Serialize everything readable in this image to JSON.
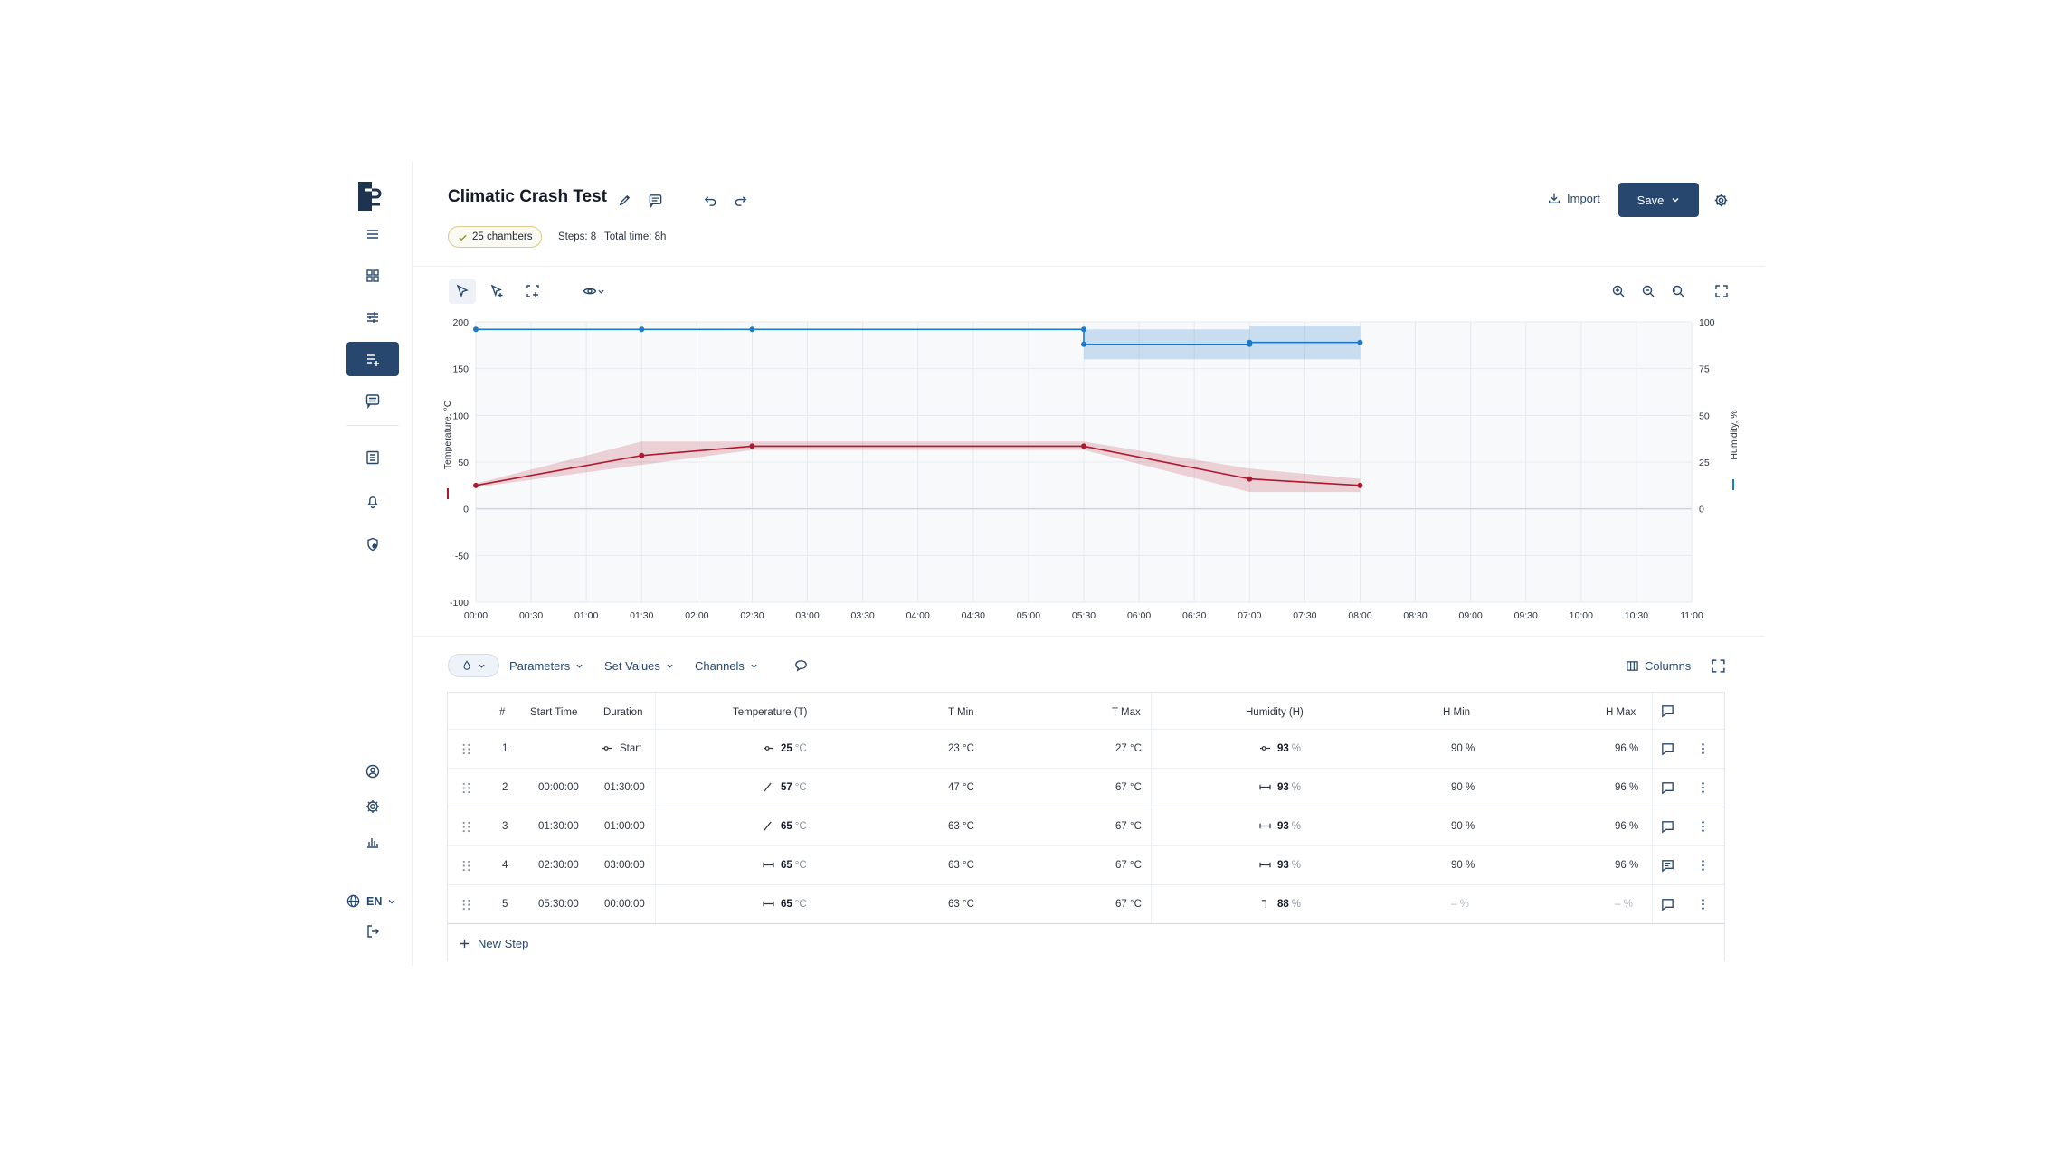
{
  "colors": {
    "accent": "#27476e",
    "temperature": "#b0182f",
    "humidity": "#1e7ac6",
    "chip_border": "#d9c98a"
  },
  "header": {
    "title": "Climatic Crash Test",
    "chambers_chip": "25 chambers",
    "steps": "Steps: 8",
    "total_time": "Total time: 8h",
    "import_label": "Import",
    "save_label": "Save"
  },
  "sidebar": {
    "language": "EN",
    "items": [
      {
        "icon": "logo-icon"
      },
      {
        "icon": "menu-icon"
      },
      {
        "icon": "dashboard-grid-icon"
      },
      {
        "icon": "sliders-icon"
      },
      {
        "icon": "profile-editor-icon",
        "active": true
      },
      {
        "icon": "messages-icon"
      },
      {
        "icon": "list-icon"
      },
      {
        "icon": "bell-icon"
      },
      {
        "icon": "badge-icon"
      },
      {
        "icon": "user-icon"
      },
      {
        "icon": "settings-icon"
      },
      {
        "icon": "stats-icon"
      },
      {
        "icon": "globe-icon"
      },
      {
        "icon": "logout-icon"
      }
    ]
  },
  "chart_data": {
    "type": "line",
    "x_ticks": [
      "00:00",
      "00:30",
      "01:00",
      "01:30",
      "02:00",
      "02:30",
      "03:00",
      "03:30",
      "04:00",
      "04:30",
      "05:00",
      "05:30",
      "06:00",
      "06:30",
      "07:00",
      "07:30",
      "08:00",
      "08:30",
      "09:00",
      "09:30",
      "10:00",
      "10:30",
      "11:00"
    ],
    "xlim_hours": [
      0,
      11
    ],
    "y_left": {
      "label": "Temperature, °C",
      "ticks": [
        200,
        150,
        100,
        50,
        0,
        -50,
        -100
      ],
      "lim": [
        -100,
        200
      ]
    },
    "y_right": {
      "label": "Humidity, %",
      "ticks": [
        100,
        75,
        50,
        25,
        0
      ],
      "lim": [
        -50,
        100
      ]
    },
    "grid": true,
    "series": [
      {
        "name": "Temperature",
        "axis": "left",
        "points": [
          [
            0,
            25
          ],
          [
            1.5,
            57
          ],
          [
            2.5,
            67
          ],
          [
            5.5,
            67
          ],
          [
            7,
            32
          ],
          [
            8,
            25
          ]
        ],
        "band_min": [
          [
            0,
            23
          ],
          [
            1.5,
            47
          ],
          [
            2.5,
            63
          ],
          [
            5.5,
            63
          ],
          [
            7,
            18
          ],
          [
            8,
            18
          ]
        ],
        "band_max": [
          [
            0,
            27
          ],
          [
            1.5,
            72
          ],
          [
            2.5,
            72
          ],
          [
            5.5,
            72
          ],
          [
            7,
            43
          ],
          [
            8,
            32
          ]
        ]
      },
      {
        "name": "Humidity",
        "axis": "right",
        "points": [
          [
            0,
            96
          ],
          [
            1.5,
            96
          ],
          [
            2.5,
            96
          ],
          [
            5.5,
            96
          ],
          [
            5.5,
            88
          ],
          [
            7,
            88
          ],
          [
            7,
            89
          ],
          [
            8,
            89
          ]
        ],
        "bands": [
          {
            "x": [
              5.5,
              7
            ],
            "min": 80,
            "max": 96
          },
          {
            "x": [
              7,
              8
            ],
            "min": 80,
            "max": 98
          }
        ]
      }
    ]
  },
  "filter_bar": {
    "parameters": "Parameters",
    "set_values": "Set Values",
    "channels": "Channels",
    "columns": "Columns"
  },
  "table": {
    "headers": [
      "#",
      "Start Time",
      "Duration",
      "Temperature (T)",
      "T Min",
      "T Max",
      "Humidity (H)",
      "H Min",
      "H Max"
    ],
    "rows": [
      {
        "n": "1",
        "start": "",
        "duration": "Start",
        "t_icon": "hold-icon",
        "t": "25",
        "t_unit": "°C",
        "tmin": "23 °C",
        "tmax": "27 °C",
        "h_icon": "hold-icon",
        "h": "93",
        "h_unit": "%",
        "hmin": "90 %",
        "hmax": "96 %"
      },
      {
        "n": "2",
        "start": "00:00:00",
        "duration": "01:30:00",
        "t_icon": "ramp-icon",
        "t": "57",
        "t_unit": "°C",
        "tmin": "47 °C",
        "tmax": "67 °C",
        "h_icon": "constant-icon",
        "h": "93",
        "h_unit": "%",
        "hmin": "90 %",
        "hmax": "96 %"
      },
      {
        "n": "3",
        "start": "01:30:00",
        "duration": "01:00:00",
        "t_icon": "ramp-icon",
        "t": "65",
        "t_unit": "°C",
        "tmin": "63 °C",
        "tmax": "67 °C",
        "h_icon": "constant-icon",
        "h": "93",
        "h_unit": "%",
        "hmin": "90 %",
        "hmax": "96 %"
      },
      {
        "n": "4",
        "start": "02:30:00",
        "duration": "03:00:00",
        "t_icon": "constant-icon",
        "t": "65",
        "t_unit": "°C",
        "tmin": "63 °C",
        "tmax": "67 °C",
        "h_icon": "constant-icon",
        "h": "93",
        "h_unit": "%",
        "hmin": "90 %",
        "hmax": "96 %"
      },
      {
        "n": "5",
        "start": "05:30:00",
        "duration": "00:00:00",
        "t_icon": "constant-icon",
        "t": "65",
        "t_unit": "°C",
        "tmin": "63 °C",
        "tmax": "67 °C",
        "h_icon": "step-icon",
        "h": "88",
        "h_unit": "%",
        "hmin": "– %",
        "hmax": "– %"
      }
    ],
    "new_step": "New Step"
  }
}
